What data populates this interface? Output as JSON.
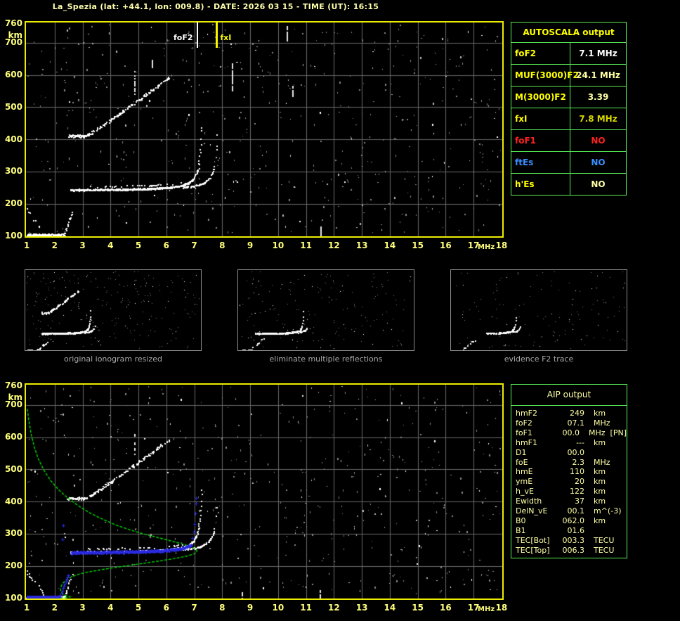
{
  "title": "La_Spezia (lat: +44.1, lon: 009.8) - DATE: 2026 03 15 - TIME (UT): 16:15",
  "colors": {
    "background": "#000000",
    "chart_border": "#eded00",
    "grid": "#6a6a6a",
    "axis_label": "#ffff7d",
    "table_border": "#58ef58",
    "pale_yellow": "#ffffa6",
    "bright_yellow": "#ffff00",
    "red": "#ff2020",
    "blue": "#3b8eff",
    "green_profile": "#00dc00",
    "blue_trace": "#2a2ae0",
    "caption_gray": "#a9a9a9"
  },
  "axis": {
    "y_unit": "km",
    "x_unit": "MHz",
    "y_ticks": [
      "760",
      "700",
      "600",
      "500",
      "400",
      "300",
      "200",
      "100"
    ],
    "x_ticks": [
      "1",
      "2",
      "3",
      "4",
      "5",
      "6",
      "7",
      "8",
      "9",
      "10",
      "11",
      "12",
      "13",
      "14",
      "15",
      "16",
      "17",
      "18"
    ]
  },
  "top_chart": {
    "foF2_label": "foF2",
    "foF2_mhz": 7.1,
    "fxI_label": "fxI",
    "fxI_mhz": 7.8
  },
  "autoscala_table": {
    "header": "AUTOSCALA output",
    "rows": [
      {
        "label": "foF2",
        "value": "7.1 MHz",
        "label_color": "#ffff00",
        "value_color": "#ffffff"
      },
      {
        "label": "MUF(3000)F2",
        "value": "24.1 MHz",
        "label_color": "#ffff00",
        "value_color": "#ffffa6"
      },
      {
        "label": "M(3000)F2",
        "value": "3.39",
        "label_color": "#ffff00",
        "value_color": "#ffffa6"
      },
      {
        "label": "fxI",
        "value": "7.8 MHz",
        "label_color": "#ffff00",
        "value_color": "#d8d800"
      },
      {
        "label": "foF1",
        "value": "NO",
        "label_color": "#ff2020",
        "value_color": "#ff2020"
      },
      {
        "label": "ftEs",
        "value": "NO",
        "label_color": "#3b8eff",
        "value_color": "#3b8eff"
      },
      {
        "label": "h'Es",
        "value": "NO",
        "label_color": "#ffff00",
        "value_color": "#ffffa6"
      }
    ]
  },
  "thumbnails": [
    {
      "caption": "original ionogram resized"
    },
    {
      "caption": "eliminate multiple reflections"
    },
    {
      "caption": "evidence F2 trace"
    }
  ],
  "aip_table": {
    "header": "AIP output",
    "rows": [
      {
        "label": "hmF2",
        "value": "249",
        "unit": "km"
      },
      {
        "label": "foF2",
        "value": "07.1",
        "unit": "MHz"
      },
      {
        "label": "foF1",
        "value": "00.0",
        "unit": "MHz  [PN]"
      },
      {
        "label": "hmF1",
        "value": "---",
        "unit": "km"
      },
      {
        "label": "D1",
        "value": "00.0",
        "unit": ""
      },
      {
        "label": "foE",
        "value": "2.3",
        "unit": "MHz"
      },
      {
        "label": "hmE",
        "value": "110",
        "unit": "km"
      },
      {
        "label": "ymE",
        "value": "20",
        "unit": "km"
      },
      {
        "label": "h_vE",
        "value": "122",
        "unit": "km"
      },
      {
        "label": "Ewidth",
        "value": "37",
        "unit": "km"
      },
      {
        "label": "DelN_vE",
        "value": "00.1",
        "unit": "m^(-3)"
      },
      {
        "label": "B0",
        "value": "062.0",
        "unit": "km"
      },
      {
        "label": "B1",
        "value": "01.6",
        "unit": ""
      },
      {
        "label": "TEC[Bot]",
        "value": "003.3",
        "unit": "TECU"
      },
      {
        "label": "TEC[Top]",
        "value": "006.3",
        "unit": "TECU"
      }
    ]
  },
  "chart_data": [
    {
      "type": "scatter",
      "title": "Ionogram with AUTOSCALA scaled characteristics",
      "xlabel": "MHz",
      "ylabel": "km",
      "xlim": [
        1,
        18
      ],
      "ylim": [
        100,
        760
      ],
      "grid": true,
      "annotations": [
        {
          "label": "foF2",
          "x": 7.1,
          "color": "white",
          "style": "vertical-line"
        },
        {
          "label": "fxI",
          "x": 7.8,
          "color": "yellow",
          "style": "vertical-line"
        }
      ],
      "series": [
        {
          "name": "E-layer echo",
          "description": "h' ~100-110 km for f = 1.0-2.4 MHz"
        },
        {
          "name": "F2 ordinary trace",
          "description": "h' ~245-260 km for f = 2.6-6.5 MHz, rising to ~430 km approaching foF2 = 7.1 MHz"
        },
        {
          "name": "F2 extraordinary trace",
          "description": "steep branch near fxI = 7.8 MHz up to ~460 km"
        },
        {
          "name": "second-order F echo",
          "description": "h' ~410-600 km for f = 2.5-6.1 MHz"
        },
        {
          "name": "background noise",
          "description": "random speckle over full frequency range"
        }
      ]
    },
    {
      "type": "scatter",
      "title": "Ionogram with AIP restored profile and scaled F2 trace",
      "xlabel": "MHz",
      "ylabel": "km",
      "xlim": [
        1,
        18
      ],
      "ylim": [
        100,
        760
      ],
      "grid": true,
      "series": [
        {
          "name": "ionogram echoes",
          "description": "same E, F2 and second-order traces as top ionogram"
        },
        {
          "name": "scaled F2 trace (blue)",
          "description": "markers along E (~101 km, 1-2.2 MHz) and F2 trace (~240 km flat, rising to ~410 km at 7.08 MHz)"
        },
        {
          "name": "electron density profile (green)",
          "key_points": [
            [
              1.0,
              690
            ],
            [
              2.3,
              110
            ],
            [
              7.1,
              249
            ]
          ],
          "description": "true-height profile: topside at left edge ~690 km, E peak foE 2.3 MHz at hmE 110 km, F2 peak foF2 7.1 MHz at hmF2 249 km"
        }
      ]
    }
  ]
}
